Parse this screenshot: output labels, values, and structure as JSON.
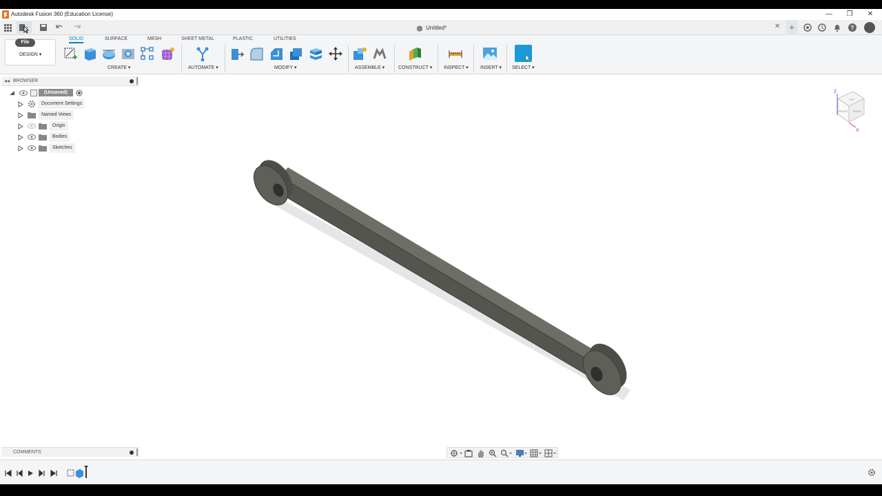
{
  "window": {
    "title": "Autodesk Fusion 360 (Education License)",
    "minimize": "—",
    "maximize": "❐",
    "close": "✕"
  },
  "document": {
    "tab_title": "Untitled*"
  },
  "toolbar": {
    "file_tooltip": "File",
    "workspace": "DESIGN ▾"
  },
  "ribbon": {
    "tabs": [
      "SOLID",
      "SURFACE",
      "MESH",
      "SHEET METAL",
      "PLASTIC",
      "UTILITIES"
    ],
    "groups": {
      "create": "CREATE ▾",
      "automate": "AUTOMATE ▾",
      "modify": "MODIFY ▾",
      "assemble": "ASSEMBLE ▾",
      "construct": "CONSTRUCT ▾",
      "inspect": "INSPECT ▾",
      "insert": "INSERT ▾",
      "select": "SELECT ▾"
    }
  },
  "browser": {
    "title": "BROWSER",
    "root": "(Unsaved)",
    "items": [
      "Document Settings",
      "Named Views",
      "Origin",
      "Bodies",
      "Sketches"
    ]
  },
  "comments": {
    "title": "COMMENTS"
  },
  "viewcube": {
    "top": "TOP",
    "front": "FRONT",
    "right": "RIGHT",
    "axis_z": "Z",
    "axis_x": "X"
  },
  "colors": {
    "accent": "#0a7fc2",
    "body": "#5b5b55",
    "select_btn": "#1a9ad6"
  }
}
